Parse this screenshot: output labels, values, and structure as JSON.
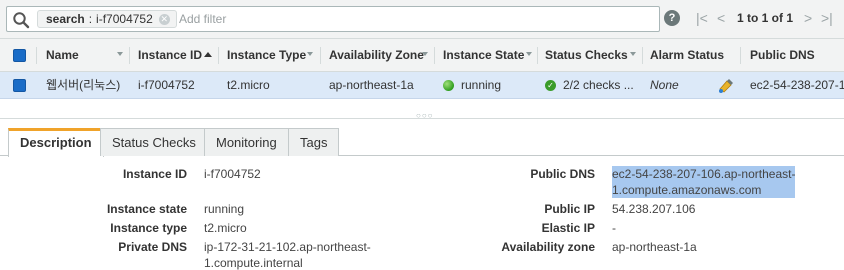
{
  "filter": {
    "token_key": "search",
    "token_sep": ":",
    "token_value": "i-f7004752",
    "placeholder": "Add filter",
    "pagination": "1 to 1 of 1"
  },
  "columns": {
    "name": "Name",
    "instance_id": "Instance ID",
    "instance_type": "Instance Type",
    "availability_zone": "Availability Zone",
    "instance_state": "Instance State",
    "status_checks": "Status Checks",
    "alarm_status": "Alarm Status",
    "public_dns": "Public DNS"
  },
  "row": {
    "name": "웹서버(리눅스)",
    "instance_id": "i-f7004752",
    "instance_type": "t2.micro",
    "availability_zone": "ap-northeast-1a",
    "instance_state": "running",
    "status_checks": "2/2 checks ...",
    "alarm_status": "None",
    "public_dns": "ec2-54-238-207-10"
  },
  "tabs": [
    "Description",
    "Status Checks",
    "Monitoring",
    "Tags"
  ],
  "details": {
    "instance_id_label": "Instance ID",
    "instance_id": "i-f7004752",
    "instance_state_label": "Instance state",
    "instance_state": "running",
    "instance_type_label": "Instance type",
    "instance_type": "t2.micro",
    "private_dns_label": "Private DNS",
    "private_dns_1": "ip-172-31-21-102.ap-northeast-",
    "private_dns_2": "1.compute.internal",
    "public_dns_label": "Public DNS",
    "public_dns_1": "ec2-54-238-207-106.ap-northeast-",
    "public_dns_2": "1.compute.amazonaws.com",
    "public_ip_label": "Public IP",
    "public_ip": "54.238.207.106",
    "elastic_ip_label": "Elastic IP",
    "elastic_ip": "-",
    "availability_zone_label": "Availability zone",
    "availability_zone": "ap-northeast-1a"
  },
  "colors": {
    "selected_row": "#dce9f8",
    "active_tab_accent": "#f0a32a",
    "running_green": "#2f9e1f",
    "selection_highlight": "#a7c8ef"
  },
  "icons": [
    "search-icon",
    "clear-token-icon",
    "help-icon",
    "first-page-icon",
    "prev-page-icon",
    "next-page-icon",
    "last-page-icon",
    "running-status-icon",
    "status-check-ok-icon",
    "create-alarm-icon"
  ]
}
